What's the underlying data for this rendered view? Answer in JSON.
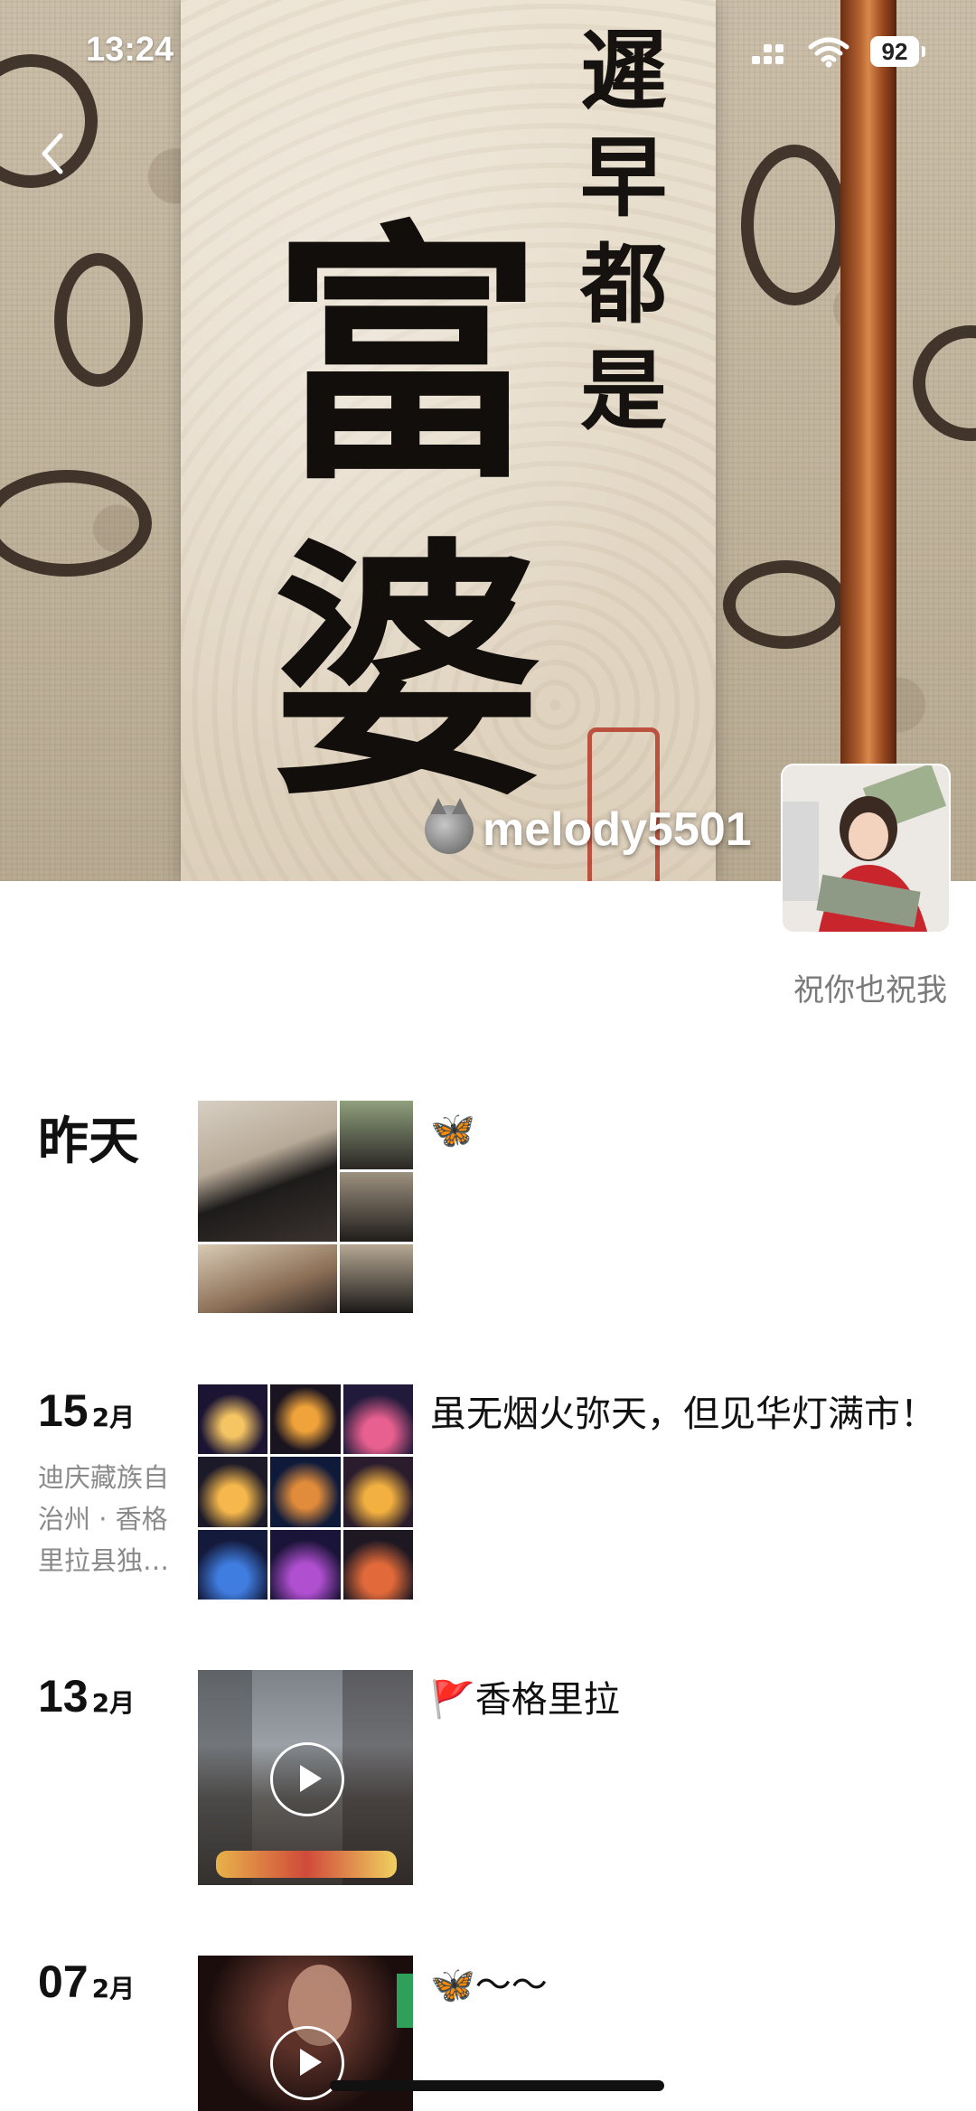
{
  "status": {
    "time": "13:24",
    "battery": "92"
  },
  "cover": {
    "calligraphy_small": "遲早都是",
    "calligraphy_big": "富婆",
    "name": "melody5501",
    "signature": "祝你也祝我",
    "icons": [
      "back-icon",
      "wolf-icon",
      "signal-icon",
      "wifi-icon",
      "battery-icon"
    ]
  },
  "posts": [
    {
      "date_word": "昨天",
      "text": "🦋",
      "media": "photo-grid"
    },
    {
      "day": "15",
      "month": "2月",
      "location": "迪庆藏族自治州 · 香格里拉县独…",
      "text": "虽无烟火弥天，但见华灯满市！",
      "media": "photo-grid"
    },
    {
      "day": "13",
      "month": "2月",
      "text": "🚩香格里拉",
      "media": "video"
    },
    {
      "day": "07",
      "month": "2月",
      "text": "🦋～～",
      "media": "video"
    }
  ],
  "colors": {
    "accent_seal": "#b0321f",
    "rod": "#b4622f",
    "meta_text": "#8a8a8a"
  }
}
